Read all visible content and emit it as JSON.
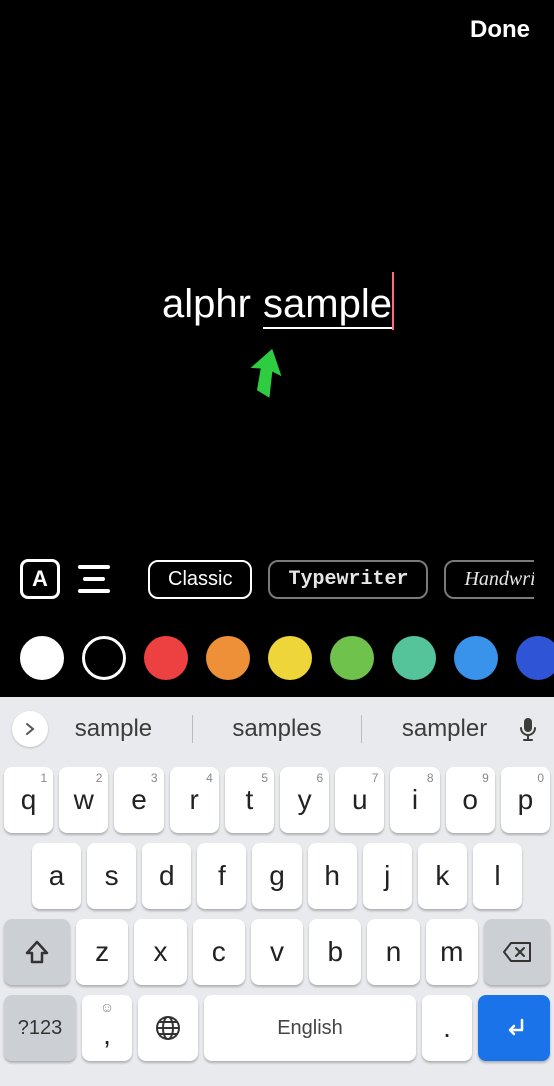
{
  "header": {
    "done_label": "Done"
  },
  "text": {
    "word1": "alphr",
    "word2": "sample"
  },
  "toolbar": {
    "text_style_icon": "A",
    "fonts": [
      {
        "label": "Classic",
        "style": "classic",
        "selected": true
      },
      {
        "label": "Typewriter",
        "style": "typewriter",
        "selected": false
      },
      {
        "label": "Handwri",
        "style": "handwrite",
        "selected": false
      }
    ]
  },
  "colors": [
    {
      "hex": "#ffffff",
      "selected": true
    },
    {
      "hex": "#000000",
      "outline": true
    },
    {
      "hex": "#ed4040"
    },
    {
      "hex": "#ed9038"
    },
    {
      "hex": "#edd53a"
    },
    {
      "hex": "#6fc24b"
    },
    {
      "hex": "#55c49a"
    },
    {
      "hex": "#3a93ea"
    },
    {
      "hex": "#2f54d6"
    }
  ],
  "keyboard": {
    "suggestions": [
      "sample",
      "samples",
      "sampler"
    ],
    "row1": [
      {
        "k": "q",
        "h": "1"
      },
      {
        "k": "w",
        "h": "2"
      },
      {
        "k": "e",
        "h": "3"
      },
      {
        "k": "r",
        "h": "4"
      },
      {
        "k": "t",
        "h": "5"
      },
      {
        "k": "y",
        "h": "6"
      },
      {
        "k": "u",
        "h": "7"
      },
      {
        "k": "i",
        "h": "8"
      },
      {
        "k": "o",
        "h": "9"
      },
      {
        "k": "p",
        "h": "0"
      }
    ],
    "row2": [
      "a",
      "s",
      "d",
      "f",
      "g",
      "h",
      "j",
      "k",
      "l"
    ],
    "row3": [
      "z",
      "x",
      "c",
      "v",
      "b",
      "n",
      "m"
    ],
    "symnum": "?123",
    "comma": ",",
    "space": "English",
    "period": "."
  }
}
